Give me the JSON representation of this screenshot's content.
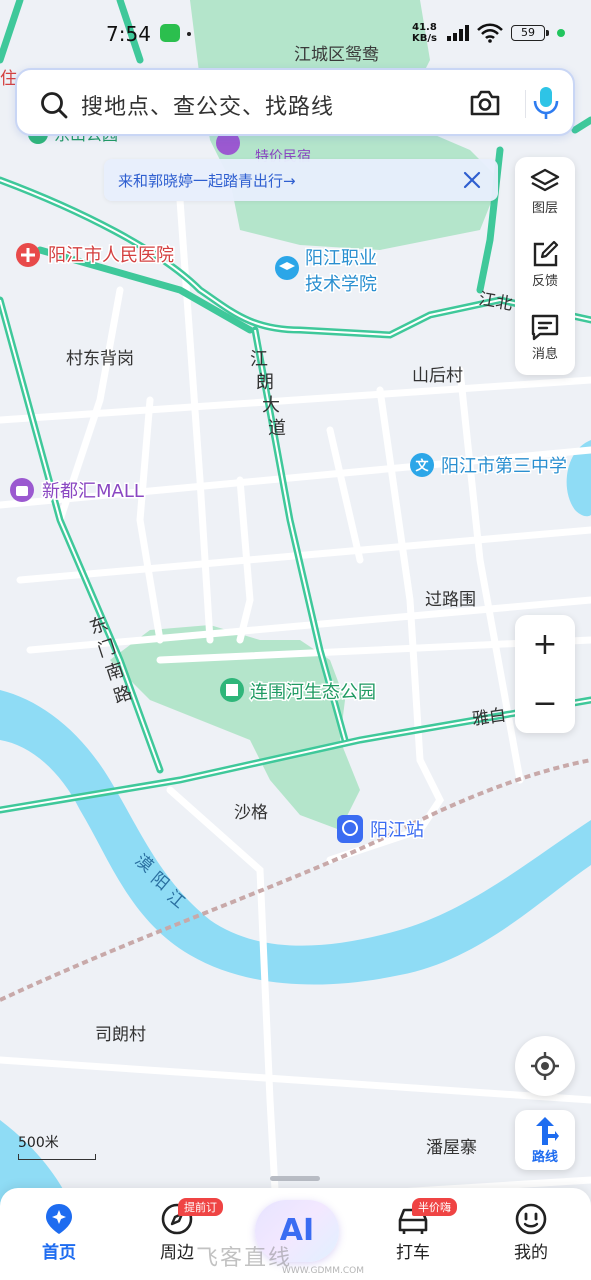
{
  "status_bar": {
    "time": "7:54",
    "net_speed_value": "41.8",
    "net_speed_unit": "KB/s",
    "battery": "59",
    "accent_green": "#22c55e"
  },
  "search": {
    "placeholder": "搜地点、查公交、找路线",
    "search_icon": "search-icon",
    "camera_icon": "camera-icon",
    "mic_icon": "microphone-icon"
  },
  "banner": {
    "text": "来和郭晓婷一起踏青出行→",
    "close_icon": "close-icon"
  },
  "map_tools": {
    "layers_label": "图层",
    "feedback_label": "反馈",
    "messages_label": "消息"
  },
  "zoom": {
    "zoom_in_label": "+",
    "zoom_out_label": "−"
  },
  "route_button_label": "路线",
  "scale_label": "500米",
  "map": {
    "road_color": "#3fc89a",
    "water_color": "#8fdcf5",
    "park_color": "#a9e3c3",
    "places": {
      "jiangcheng": "江城区鸳鸯",
      "hospital": "阳江市人民医院",
      "college_line1": "阳江职业",
      "college_line2": "技术学院",
      "cundong": "村东背岗",
      "shanhou": "山后村",
      "school3": "阳江市第三中学",
      "mall": "新都汇MALL",
      "guolu": "过路围",
      "park": "连围河生态公园",
      "shage": "沙格",
      "station": "阳江站",
      "silang": "司朗村",
      "panwu": "潘屋寨",
      "jiangbei": "江北",
      "zhu": "住",
      "gongyuan": "东山公园",
      "hotel": "特价民宿"
    },
    "roads": {
      "jianglang": "江朗大道",
      "dongmen": "东门南路",
      "yabai": "雅白",
      "moyang": "漠阳江"
    }
  },
  "tabs": [
    {
      "label": "首页",
      "active": true,
      "icon": "home-pin-icon"
    },
    {
      "label": "周边",
      "active": false,
      "icon": "compass-icon",
      "badge": "提前订"
    },
    {
      "label": "AI",
      "active": false,
      "icon": "ai-icon"
    },
    {
      "label": "打车",
      "active": false,
      "icon": "car-icon",
      "badge": "半价嗨"
    },
    {
      "label": "我的",
      "active": false,
      "icon": "profile-icon"
    }
  ],
  "watermark": {
    "text": "飞客直线",
    "url": "WWW.GDMM.COM"
  }
}
